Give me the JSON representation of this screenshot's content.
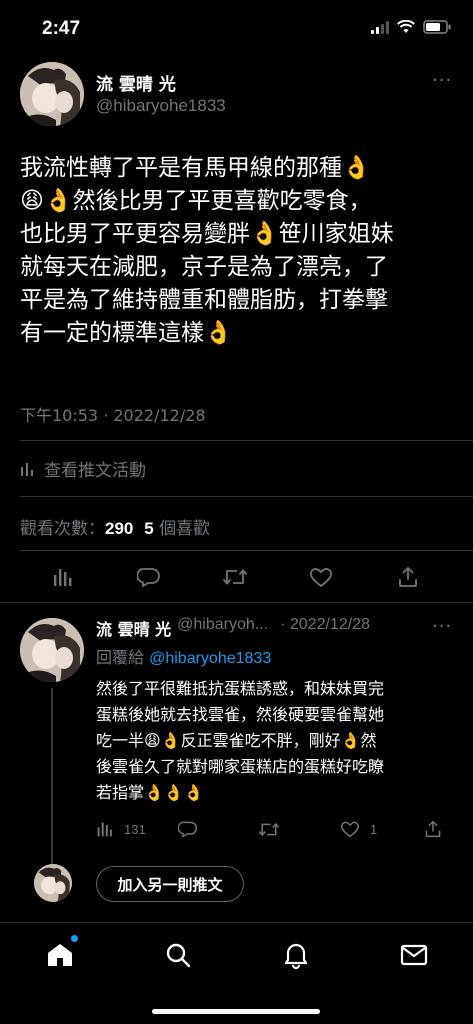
{
  "status_bar": {
    "time": "2:47"
  },
  "main_tweet": {
    "author_name": "流 雲晴 光",
    "author_handle": "@hibaryohe1833",
    "more": "···",
    "text_lines": [
      "我流性轉了平是有馬甲線的那種👌",
      "😩👌然後比男了平更喜歡吃零食，",
      "也比男了平更容易變胖👌笹川家姐妹",
      "就每天在減肥，京子是為了漂亮，了",
      "平是為了維持體重和體脂肪，打拳擊",
      "有一定的標準這樣👌"
    ],
    "timestamp": "下午10:53 · 2022/12/28",
    "activity_label": "查看推文活動",
    "views_label": "觀看次數：",
    "views_count": "290",
    "likes_count": "5",
    "likes_label": "個喜歡"
  },
  "reply": {
    "author_name": "流 雲晴 光",
    "author_handle": "@hibaryoh...",
    "date": "· 2022/12/28",
    "more": "···",
    "reply_to_label": "回覆給",
    "reply_to_handle": "@hibaryohe1833",
    "text_lines": [
      "然後了平很難抵抗蛋糕誘惑，和妹妹買完",
      "蛋糕後她就去找雲雀，然後硬要雲雀幫她",
      "吃一半😩👌反正雲雀吃不胖，剛好👌然",
      "後雲雀久了就對哪家蛋糕店的蛋糕好吃瞭",
      "若指掌👌👌👌"
    ],
    "views_count": "131",
    "likes_count": "1"
  },
  "add_tweet_label": "加入另一則推文",
  "icons": {
    "stats": "bar-chart-icon",
    "reply": "comment-icon",
    "retweet": "retweet-icon",
    "like": "heart-icon",
    "share": "share-icon",
    "home": "home-icon",
    "search": "search-icon",
    "notifications": "bell-icon",
    "messages": "mail-icon"
  },
  "colors": {
    "background": "#000000",
    "accent": "#1d9bf0",
    "muted": "#71767b",
    "divider": "#2f3336"
  }
}
